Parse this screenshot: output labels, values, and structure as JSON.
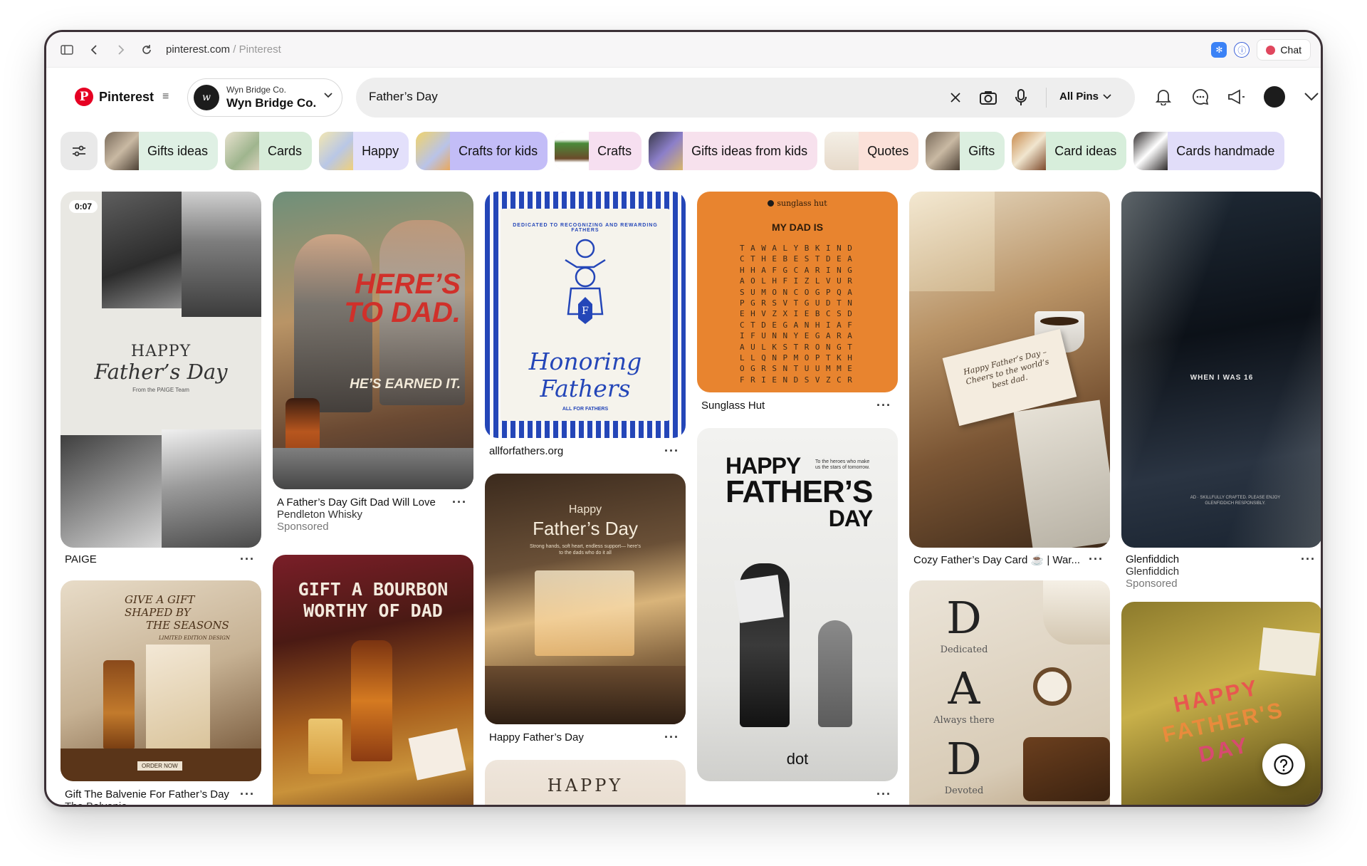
{
  "browser": {
    "url_domain": "pinterest.com",
    "url_sep": " / ",
    "url_title": "Pinterest",
    "chat_label": "Chat"
  },
  "header": {
    "brand": "Pinterest",
    "account_small": "Wyn Bridge Co.",
    "account_big": "Wyn Bridge Co.",
    "search_value": "Father’s Day",
    "scope_label": "All Pins"
  },
  "chips": [
    {
      "label": "Gifts ideas",
      "bg": "#dff0e4"
    },
    {
      "label": "Cards",
      "bg": "#d7ecd9"
    },
    {
      "label": "Happy",
      "bg": "#e3e0fb"
    },
    {
      "label": "Crafts for kids",
      "bg": "#c3bdf7"
    },
    {
      "label": "Crafts",
      "bg": "#f6dff0"
    },
    {
      "label": "Gifts ideas from kids",
      "bg": "#f7e1ed"
    },
    {
      "label": "Quotes",
      "bg": "#fbe1d9"
    },
    {
      "label": "Gifts",
      "bg": "#dcefe0"
    },
    {
      "label": "Card ideas",
      "bg": "#d7eedb"
    },
    {
      "label": "Cards handmade",
      "bg": "#e1ddf9"
    }
  ],
  "pins": {
    "paige": {
      "duration": "0:07",
      "happy": "HAPPY",
      "fathers_day": "Father’s Day",
      "from_team": "From the PAIGE Team",
      "caption": "PAIGE",
      "dots": "···"
    },
    "pendleton": {
      "headline1": "HERE’S",
      "headline2": "TO DAD.",
      "tagline": "HE’S EARNED IT.",
      "caption": "A Father’s Day Gift Dad Will Love",
      "sub": "Pendleton Whisky",
      "spon": "Sponsored",
      "dots": "···"
    },
    "honoring": {
      "arc_text": "DEDICATED TO RECOGNIZING AND REWARDING FATHERS",
      "title1": "Honoring",
      "title2": "Fathers",
      "small": "ALL FOR FATHERS",
      "caption": "allforfathers.org",
      "dots": "···"
    },
    "sunglass": {
      "brand": "sunglass hut",
      "heading": "MY DAD IS",
      "grid": [
        "TAWALYBKIND",
        "CTHEBESTDEA",
        "HHAFGCARING",
        "AOLHFIZLVUR",
        "SUMONCOGPQA",
        "PGRSVTGUDTN",
        "EHVZXIEBCSD",
        "CTDEGANHIAF",
        "IFUNNYEGARA",
        "AULKSTRONGT",
        "LLQNPMOPTKH",
        "OGRSNTUUMME",
        "FRIENDSVZCR"
      ],
      "caption": "Sunglass Hut",
      "dots": "···"
    },
    "cozy": {
      "card_text": "Happy Father’s Day – Cheers to the world’s best dad.",
      "caption": "Cozy Father’s Day Card ☕ | War...",
      "dots": "···"
    },
    "glenfiddich": {
      "overlay": "WHEN I WAS 16",
      "fine": "AD · SKILLFULLY CRAFTED. PLEASE ENJOY GLENFIDDICH RESPONSIBLY.",
      "caption": "Glenfiddich",
      "sub": "Glenfiddich",
      "spon": "Sponsored",
      "dots": "···"
    },
    "balvenie": {
      "line1": "GIVE A GIFT",
      "line2": "SHAPED BY",
      "line3": "THE SEASONS",
      "line4": "LIMITED EDITION DESIGN",
      "btn": "ORDER NOW",
      "caption": "Gift The Balvenie For Father’s Day",
      "sub": "The Balvenie",
      "dots": "···"
    },
    "bourbon": {
      "line1": "GIFT A BOURBON",
      "line2": "WORTHY OF DAD"
    },
    "happy_fd": {
      "small": "Happy",
      "big": "Father’s Day",
      "tag": "Strong hands, soft heart, endless support— here’s to the dads who do it all",
      "caption": "Happy Father’s Day",
      "dots": "···"
    },
    "happy_bottom": {
      "text": "HAPPY"
    },
    "dot": {
      "happy": "HAPPY",
      "fathers": "FATHER’S",
      "day": "DAY",
      "heroes": "To the heroes who make us the stars of tomorrow.",
      "logo": "dot",
      "dots": "···"
    },
    "dad": {
      "d1": "D",
      "w1": "Dedicated",
      "a": "A",
      "w2": "Always there",
      "d2": "D",
      "w3": "Devoted"
    },
    "magnets": {
      "line1": "HAPPY",
      "line2": "FATHER'S",
      "line3": "DAY"
    }
  },
  "help_icon": "?"
}
